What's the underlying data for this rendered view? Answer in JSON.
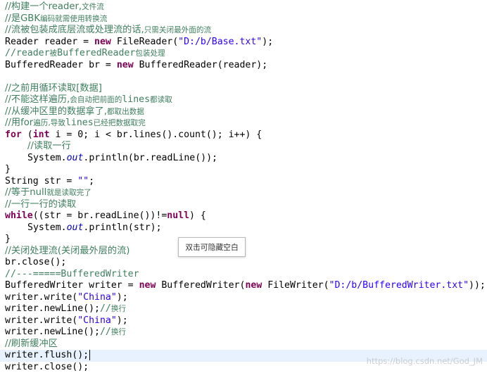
{
  "colors": {
    "comment": "#3f7f5f",
    "keyword": "#7f0055",
    "string": "#2a00ff",
    "field": "#0000c0",
    "current_line": "#e8f2fe"
  },
  "code": [
    {
      "tokens": [
        {
          "t": "//构建一个reader,",
          "k": "comment"
        },
        {
          "t": "文件流",
          "k": "comment small"
        }
      ]
    },
    {
      "tokens": [
        {
          "t": "//是GBK",
          "k": "comment"
        },
        {
          "t": "编码就需使用转换流",
          "k": "comment small"
        }
      ]
    },
    {
      "tokens": [
        {
          "t": "//流被包装成底层流或处理流的话,",
          "k": "comment"
        },
        {
          "t": "只需关闭最外面的流",
          "k": "comment small"
        }
      ]
    },
    {
      "tokens": [
        {
          "t": "Reader ",
          "k": ""
        },
        {
          "t": "reader",
          "k": "plain"
        },
        {
          "t": " = ",
          "k": ""
        },
        {
          "t": "new",
          "k": "kw"
        },
        {
          "t": " FileReader(",
          "k": ""
        },
        {
          "t": "\"D:/b/Base.txt\"",
          "k": "str"
        },
        {
          "t": ");",
          "k": ""
        }
      ]
    },
    {
      "tokens": [
        {
          "t": "//reader",
          "k": "comment"
        },
        {
          "t": "被",
          "k": "comment small"
        },
        {
          "t": "BufferedReader",
          "k": "comment"
        },
        {
          "t": "包装处理",
          "k": "comment small"
        }
      ]
    },
    {
      "tokens": [
        {
          "t": "BufferedReader ",
          "k": ""
        },
        {
          "t": "br",
          "k": "plain"
        },
        {
          "t": " = ",
          "k": ""
        },
        {
          "t": "new",
          "k": "kw"
        },
        {
          "t": " BufferedReader(reader);",
          "k": ""
        }
      ]
    },
    {
      "tokens": [
        {
          "t": "",
          "k": ""
        }
      ]
    },
    {
      "tokens": [
        {
          "t": "//之前用循环读取[数据]",
          "k": "comment"
        }
      ]
    },
    {
      "tokens": [
        {
          "t": "//不能这样遍历,",
          "k": "comment"
        },
        {
          "t": "会自动把前面的",
          "k": "comment small"
        },
        {
          "t": "lines",
          "k": "comment"
        },
        {
          "t": "都读取",
          "k": "comment small"
        }
      ]
    },
    {
      "tokens": [
        {
          "t": "//从缓冲区里的数据拿了,",
          "k": "comment"
        },
        {
          "t": "都取出数据",
          "k": "comment small"
        }
      ]
    },
    {
      "tokens": [
        {
          "t": "//用for",
          "k": "comment"
        },
        {
          "t": "遍历,导致",
          "k": "comment small"
        },
        {
          "t": "lines",
          "k": "comment"
        },
        {
          "t": "已经把数据取完",
          "k": "comment small"
        }
      ]
    },
    {
      "tokens": [
        {
          "t": "for",
          "k": "kw"
        },
        {
          "t": " (",
          "k": ""
        },
        {
          "t": "int",
          "k": "kw"
        },
        {
          "t": " i = 0; i < br.lines().count(); i++) {",
          "k": ""
        }
      ]
    },
    {
      "tab": true,
      "tokens": [
        {
          "t": "//读取一行",
          "k": "comment"
        }
      ]
    },
    {
      "tab": true,
      "tokens": [
        {
          "t": "System.",
          "k": ""
        },
        {
          "t": "out",
          "k": "static"
        },
        {
          "t": ".println(br.readLine());",
          "k": ""
        }
      ]
    },
    {
      "tokens": [
        {
          "t": "}",
          "k": ""
        }
      ]
    },
    {
      "tokens": [
        {
          "t": "String ",
          "k": ""
        },
        {
          "t": "str",
          "k": "plain"
        },
        {
          "t": " = ",
          "k": ""
        },
        {
          "t": "\"\"",
          "k": "str"
        },
        {
          "t": ";",
          "k": ""
        }
      ]
    },
    {
      "tokens": [
        {
          "t": "//等于null",
          "k": "comment"
        },
        {
          "t": "就是读取完了",
          "k": "comment small"
        }
      ]
    },
    {
      "tokens": [
        {
          "t": "//一行一行的读取",
          "k": "comment"
        }
      ]
    },
    {
      "tokens": [
        {
          "t": "while",
          "k": "kw"
        },
        {
          "t": "((str = br.readLine())!=",
          "k": ""
        },
        {
          "t": "null",
          "k": "kw"
        },
        {
          "t": ") {",
          "k": ""
        }
      ]
    },
    {
      "tab": true,
      "tokens": [
        {
          "t": "System.",
          "k": ""
        },
        {
          "t": "out",
          "k": "static"
        },
        {
          "t": ".println(str);",
          "k": ""
        }
      ]
    },
    {
      "tokens": [
        {
          "t": "}",
          "k": ""
        }
      ]
    },
    {
      "tokens": [
        {
          "t": "//关闭处理流(关闭最外层的流)",
          "k": "comment"
        }
      ]
    },
    {
      "tokens": [
        {
          "t": "br.close();",
          "k": ""
        }
      ]
    },
    {
      "tokens": [
        {
          "t": "//---=====BufferedWriter",
          "k": "comment"
        }
      ]
    },
    {
      "tokens": [
        {
          "t": "BufferedWriter ",
          "k": ""
        },
        {
          "t": "writer",
          "k": "plain"
        },
        {
          "t": " = ",
          "k": ""
        },
        {
          "t": "new",
          "k": "kw"
        },
        {
          "t": " BufferedWriter(",
          "k": ""
        },
        {
          "t": "new",
          "k": "kw"
        },
        {
          "t": " FileWriter(",
          "k": ""
        },
        {
          "t": "\"D:/b/BufferedWriter.txt\"",
          "k": "str"
        },
        {
          "t": "));",
          "k": ""
        }
      ]
    },
    {
      "tokens": [
        {
          "t": "writer.write(",
          "k": ""
        },
        {
          "t": "\"China\"",
          "k": "str"
        },
        {
          "t": ");",
          "k": ""
        }
      ]
    },
    {
      "tokens": [
        {
          "t": "writer.newLine();",
          "k": ""
        },
        {
          "t": "//",
          "k": "comment"
        },
        {
          "t": "换行",
          "k": "comment small"
        }
      ]
    },
    {
      "tokens": [
        {
          "t": "writer.write(",
          "k": ""
        },
        {
          "t": "\"China\"",
          "k": "str"
        },
        {
          "t": ");",
          "k": ""
        }
      ]
    },
    {
      "tokens": [
        {
          "t": "writer.newLine();",
          "k": ""
        },
        {
          "t": "//",
          "k": "comment"
        },
        {
          "t": "换行",
          "k": "comment small"
        }
      ]
    },
    {
      "tokens": [
        {
          "t": "//刷新缓冲区",
          "k": "comment"
        }
      ]
    },
    {
      "current": true,
      "tokens": [
        {
          "t": "writer.flush();",
          "k": ""
        },
        {
          "t": "",
          "k": "cursor"
        }
      ]
    },
    {
      "tokens": [
        {
          "t": "writer.close();",
          "k": ""
        }
      ]
    }
  ],
  "tooltip": {
    "text": "双击可隐藏空白"
  },
  "watermark": {
    "text": "https://blog.csdn.net/God_JM"
  }
}
